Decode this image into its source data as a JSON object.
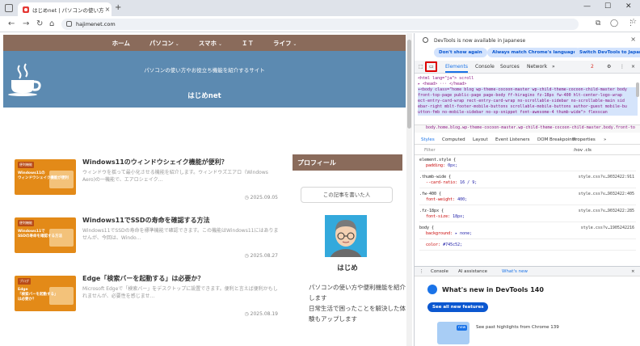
{
  "browser": {
    "tab_title": "はじめnet | パソコンの使い方を紹介",
    "url": "hajimenet.com",
    "new_tab": "+",
    "min": "—",
    "max": "☐",
    "close": "✕"
  },
  "site": {
    "menu": [
      "ホーム",
      "パソコン",
      "スマホ",
      "ＩＴ",
      "ライフ"
    ],
    "menu_dropdown": [
      false,
      true,
      true,
      false,
      true
    ],
    "tagline": "パソコンの使い方やお役立ち機能を紹介するサイト",
    "site_name": "はじめnet",
    "posts": [
      {
        "thumb_label": "便利機能",
        "thumb_caption": "Windows11の\nウィンドウシェイク機能が便利",
        "title": "Windows11のウィンドウシェイク機能が便利？",
        "excerpt": "ウィンドウを揺って最小化させる機能を紹介します。ウィンドウズエアロ（Windows Aero)の一機能で、エアロシェイク…",
        "date": "2025.09.05"
      },
      {
        "thumb_label": "便利機能",
        "thumb_caption": "Windows11で\nSSDの寿命を確認する方法",
        "title": "Windows11でSSDの寿命を確認する方法",
        "excerpt": "Windows11でSSDの寿命を標準機能で確認できます。この機能はWindows11にはありませんが、今回は、Windo…",
        "date": "2025.08.27"
      },
      {
        "thumb_label": "ブログ",
        "thumb_caption": "Edge\n「検索バーを起動する」\nは必要か？",
        "title": "Edge「検索バーを起動する」は必要か？",
        "excerpt": "Microsoft Edgeで「検索バー」をデスクトップに設置できます。便利と言えば便利かもしれませんが、必要性を感じませ…",
        "date": "2025.08.19"
      }
    ],
    "sidebar": {
      "heading": "プロフィール",
      "bubble": "この記事を書いた人",
      "name": "はじめ",
      "desc": "パソコンの使い方や便利機能を紹介します\n日常生活で困ったことを解決した体験もアップします"
    }
  },
  "devtools": {
    "notice": "DevTools is now available in Japanese",
    "btn_dont": "Don't show again",
    "btn_match": "Always match Chrome's language",
    "btn_switch": "Switch DevTools to Japanese",
    "tabs": [
      "Elements",
      "Console",
      "Sources",
      "Network",
      "»"
    ],
    "error_count": "2",
    "html_lines": [
      "<html lang=\"ja\"> scroll",
      "▸ <head> ··· </head>",
      "▾<body class=\"home blog wp-theme-cocoon-master wp-child-theme-cocoon-child-master body",
      " front-top-page public-page page-body ff-hiragino fz-18px fw-400 hlt-center-logo-wrap",
      " ect-entry-card-wrap rect-entry-card-wrap no-scrollable-sidebar no-scrollable-main sid",
      " ebar-right mblt-footer-mobile-buttons scrollable-mobile-buttons author-guest mobile-bu",
      " utton-fmb no-mobile-sidebar no-sp-snippet font-awesome-4 thumb-wide\"> flexscan"
    ],
    "breadcrumb": "body.home.blog.wp-theme-cocoon-master.wp-child-theme-cocoon-child-master.body.front-to",
    "style_tabs": [
      "Styles",
      "Computed",
      "Layout",
      "Event Listeners",
      "DOM Breakpoints",
      "Properties",
      "»"
    ],
    "filter_placeholder": "Filter",
    "filter_right": ":hov .cls",
    "rules": [
      {
        "sel": "element.style {",
        "prop": "padding",
        "val": "0px;",
        "src": ""
      },
      {
        "sel": ".thumb-wide {",
        "prop": "--card-ratio",
        "val": "16 / 9;",
        "src": "style.css?v…9032422:911"
      },
      {
        "sel": ".fw-400 {",
        "prop": "font-weight",
        "val": "400;",
        "src": "style.css?v…9032422:405"
      },
      {
        "sel": ".fz-18px {",
        "prop": "font-size",
        "val": "18px;",
        "src": "style.css?v…9032422:285"
      },
      {
        "sel": "body {",
        "prop": "background",
        "val": "▸ none;",
        "src": "style.css?v…1905242216"
      },
      {
        "sel": "",
        "prop": "color",
        "val": "#745c52;",
        "src": ""
      }
    ],
    "drawer_tabs": [
      "Console",
      "AI assistance",
      "What's new"
    ],
    "whats_new_title": "What's new in DevTools 140",
    "see_all": "See all new features",
    "new_badge": "new",
    "tip": "See past highlights from Chrome 139"
  }
}
